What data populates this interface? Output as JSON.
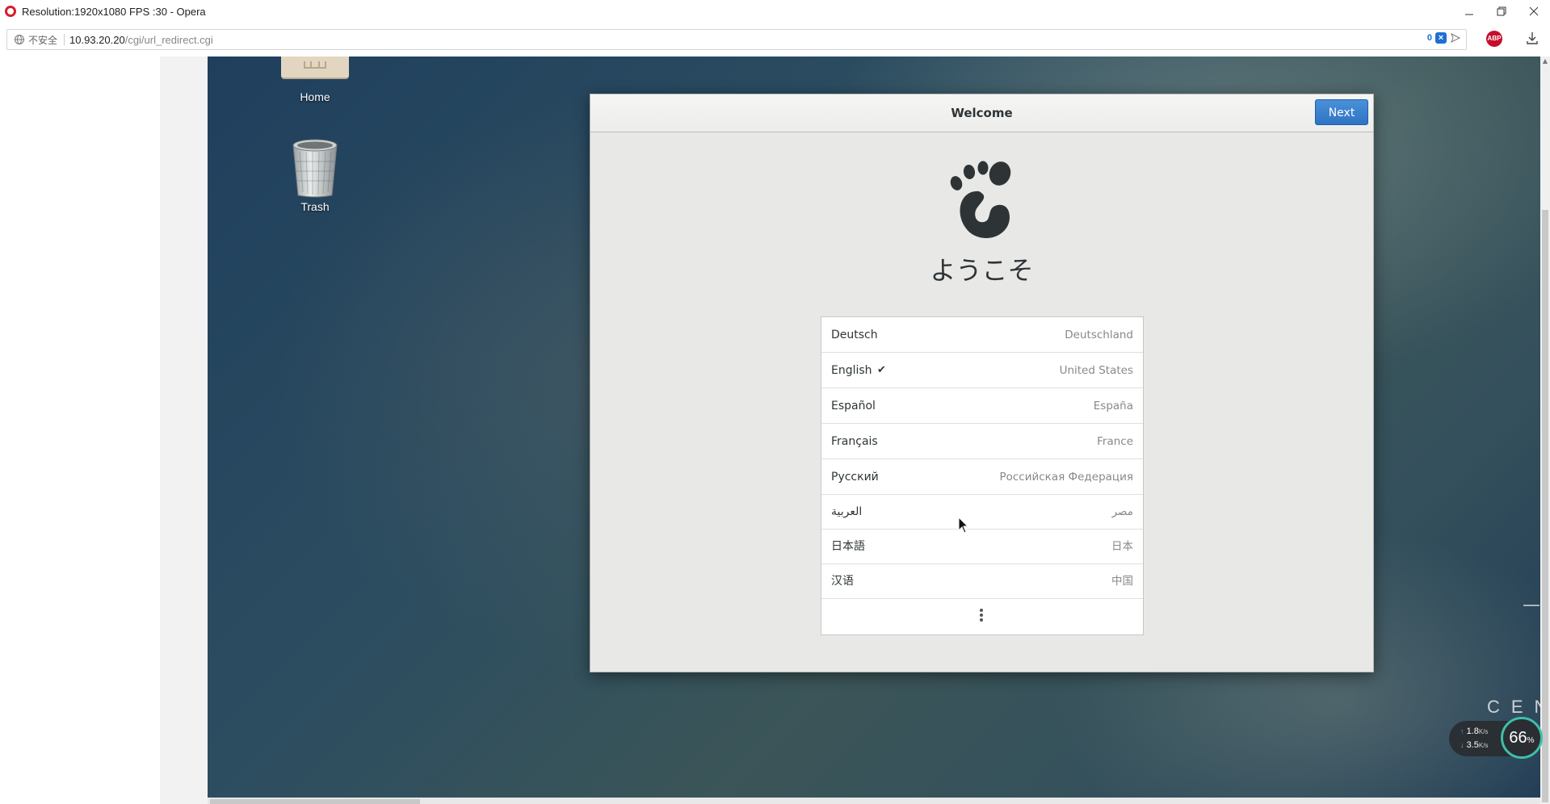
{
  "browser": {
    "window_title": "Resolution:1920x1080 FPS :30 - Opera",
    "insecure_label": "不安全",
    "url_host": "10.93.20.20",
    "url_path": "/cgi/url_redirect.cgi",
    "blocked_count": "0",
    "adblock_label": "ABP"
  },
  "desktop": {
    "icons": [
      {
        "label": "Home"
      },
      {
        "label": "Trash"
      }
    ],
    "watermark": "CEN"
  },
  "dialog": {
    "title": "Welcome",
    "next_label": "Next",
    "welcome_word": "ようこそ",
    "languages": [
      {
        "name": "Deutsch",
        "region": "Deutschland",
        "selected": false
      },
      {
        "name": "English",
        "region": "United States",
        "selected": true
      },
      {
        "name": "Español",
        "region": "España",
        "selected": false
      },
      {
        "name": "Français",
        "region": "France",
        "selected": false
      },
      {
        "name": "Русский",
        "region": "Российская Федерация",
        "selected": false
      },
      {
        "name": "العربية",
        "region": "مصر",
        "selected": false
      },
      {
        "name": "日本語",
        "region": "日本",
        "selected": false
      },
      {
        "name": "汉语",
        "region": "中国",
        "selected": false
      }
    ],
    "check_mark": "✔"
  },
  "network_widget": {
    "upload": "1.8",
    "download": "3.5",
    "unit": "K/s",
    "percent": "66",
    "percent_unit": "%"
  }
}
